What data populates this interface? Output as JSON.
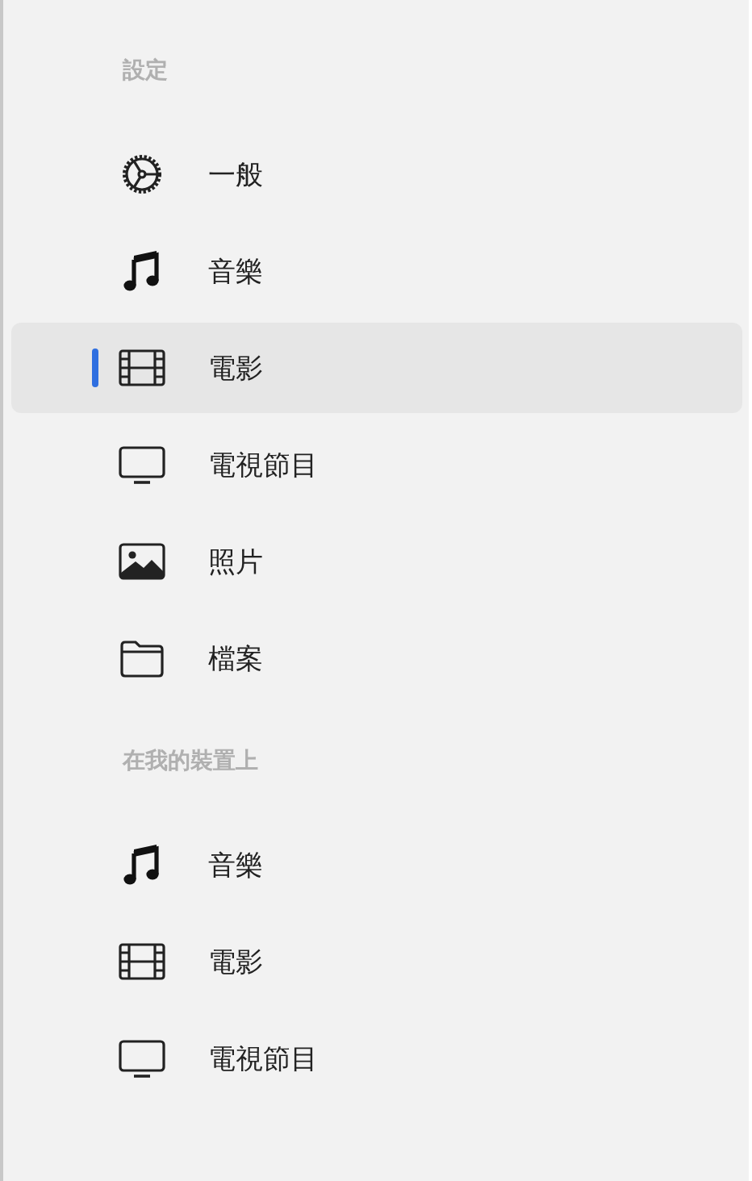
{
  "sidebar": {
    "sections": [
      {
        "title": "設定",
        "items": [
          {
            "label": "一般",
            "kind": "gear",
            "selected": false
          },
          {
            "label": "音樂",
            "kind": "music",
            "selected": false
          },
          {
            "label": "電影",
            "kind": "film",
            "selected": true
          },
          {
            "label": "電視節目",
            "kind": "tv",
            "selected": false
          },
          {
            "label": "照片",
            "kind": "photo",
            "selected": false
          },
          {
            "label": "檔案",
            "kind": "folder",
            "selected": false
          }
        ]
      },
      {
        "title": "在我的裝置上",
        "items": [
          {
            "label": "音樂",
            "kind": "music",
            "selected": false
          },
          {
            "label": "電影",
            "kind": "film",
            "selected": false
          },
          {
            "label": "電視節目",
            "kind": "tv",
            "selected": false
          }
        ]
      }
    ]
  }
}
